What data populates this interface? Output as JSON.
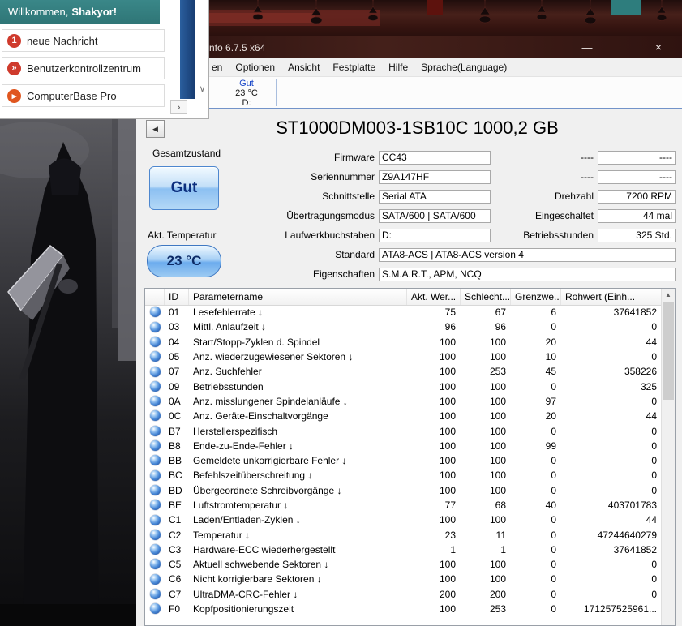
{
  "icons": {
    "back": "◀",
    "minimize": "—",
    "close": "×",
    "scroll_up": "▲",
    "chevron_down": "∨",
    "scroll_right": "›"
  },
  "overlay": {
    "title_prefix": "Willkommen,",
    "title_name": "Shakyor!",
    "items": [
      {
        "badge": "1",
        "label": "neue Nachricht"
      },
      {
        "badge": "»",
        "label": "Benutzerkontrollzentrum"
      },
      {
        "badge": "▸",
        "label": "ComputerBase Pro"
      }
    ]
  },
  "titlebar": {
    "title": "nfo 6.7.5 x64"
  },
  "menu": {
    "items": [
      "en",
      "Optionen",
      "Ansicht",
      "Festplatte",
      "Hilfe",
      "Sprache(Language)"
    ]
  },
  "drive_tab": {
    "status": "Gut",
    "temperature": "23 °C",
    "letter": "D:"
  },
  "header": {
    "model_title": "ST1000DM003-1SB10C 1000,2 GB",
    "health_label": "Gesamtzustand",
    "health_value": "Gut",
    "temp_label": "Akt. Temperatur",
    "temp_value": "23 °C"
  },
  "info": {
    "left": [
      {
        "label": "Firmware",
        "value": "CC43"
      },
      {
        "label": "Seriennummer",
        "value": "Z9A147HF"
      },
      {
        "label": "Schnittstelle",
        "value": "Serial ATA"
      },
      {
        "label": "Übertragungsmodus",
        "value": "SATA/600 | SATA/600"
      },
      {
        "label": "Laufwerkbuchstaben",
        "value": "D:"
      }
    ],
    "wide": [
      {
        "label": "Standard",
        "value": "ATA8-ACS | ATA8-ACS version 4"
      },
      {
        "label": "Eigenschaften",
        "value": "S.M.A.R.T., APM, NCQ"
      }
    ],
    "right": [
      {
        "label": "----",
        "value": "----"
      },
      {
        "label": "----",
        "value": "----"
      },
      {
        "label": "Drehzahl",
        "value": "7200 RPM"
      },
      {
        "label": "Eingeschaltet",
        "value": "44 mal"
      },
      {
        "label": "Betriebsstunden",
        "value": "325 Std."
      }
    ]
  },
  "smart": {
    "columns": {
      "id": "ID",
      "name": "Parametername",
      "current": "Akt. Wer...",
      "worst": "Schlecht...",
      "threshold": "Grenzwe...",
      "raw": "Rohwert (Einh..."
    },
    "rows": [
      {
        "id": "01",
        "name": "Lesefehlerrate ↓",
        "current": "75",
        "worst": "67",
        "threshold": "6",
        "raw": "37641852"
      },
      {
        "id": "03",
        "name": "Mittl. Anlaufzeit ↓",
        "current": "96",
        "worst": "96",
        "threshold": "0",
        "raw": "0"
      },
      {
        "id": "04",
        "name": "Start/Stopp-Zyklen d. Spindel",
        "current": "100",
        "worst": "100",
        "threshold": "20",
        "raw": "44"
      },
      {
        "id": "05",
        "name": "Anz. wiederzugewiesener Sektoren ↓",
        "current": "100",
        "worst": "100",
        "threshold": "10",
        "raw": "0"
      },
      {
        "id": "07",
        "name": "Anz. Suchfehler",
        "current": "100",
        "worst": "253",
        "threshold": "45",
        "raw": "358226"
      },
      {
        "id": "09",
        "name": "Betriebsstunden",
        "current": "100",
        "worst": "100",
        "threshold": "0",
        "raw": "325"
      },
      {
        "id": "0A",
        "name": "Anz. misslungener Spindelanläufe ↓",
        "current": "100",
        "worst": "100",
        "threshold": "97",
        "raw": "0"
      },
      {
        "id": "0C",
        "name": "Anz. Geräte-Einschaltvorgänge",
        "current": "100",
        "worst": "100",
        "threshold": "20",
        "raw": "44"
      },
      {
        "id": "B7",
        "name": "Herstellerspezifisch",
        "current": "100",
        "worst": "100",
        "threshold": "0",
        "raw": "0"
      },
      {
        "id": "B8",
        "name": "Ende-zu-Ende-Fehler ↓",
        "current": "100",
        "worst": "100",
        "threshold": "99",
        "raw": "0"
      },
      {
        "id": "BB",
        "name": "Gemeldete unkorrigierbare Fehler ↓",
        "current": "100",
        "worst": "100",
        "threshold": "0",
        "raw": "0"
      },
      {
        "id": "BC",
        "name": "Befehlszeitüberschreitung ↓",
        "current": "100",
        "worst": "100",
        "threshold": "0",
        "raw": "0"
      },
      {
        "id": "BD",
        "name": "Übergeordnete Schreibvorgänge ↓",
        "current": "100",
        "worst": "100",
        "threshold": "0",
        "raw": "0"
      },
      {
        "id": "BE",
        "name": "Luftstromtemperatur ↓",
        "current": "77",
        "worst": "68",
        "threshold": "40",
        "raw": "403701783"
      },
      {
        "id": "C1",
        "name": "Laden/Entladen-Zyklen ↓",
        "current": "100",
        "worst": "100",
        "threshold": "0",
        "raw": "44"
      },
      {
        "id": "C2",
        "name": "Temperatur ↓",
        "current": "23",
        "worst": "11",
        "threshold": "0",
        "raw": "47244640279"
      },
      {
        "id": "C3",
        "name": "Hardware-ECC wiederhergestellt",
        "current": "1",
        "worst": "1",
        "threshold": "0",
        "raw": "37641852"
      },
      {
        "id": "C5",
        "name": "Aktuell schwebende Sektoren ↓",
        "current": "100",
        "worst": "100",
        "threshold": "0",
        "raw": "0"
      },
      {
        "id": "C6",
        "name": "Nicht korrigierbare Sektoren ↓",
        "current": "100",
        "worst": "100",
        "threshold": "0",
        "raw": "0"
      },
      {
        "id": "C7",
        "name": "UltraDMA-CRC-Fehler ↓",
        "current": "200",
        "worst": "200",
        "threshold": "0",
        "raw": "0"
      },
      {
        "id": "F0",
        "name": "Kopfpositionierungszeit",
        "current": "100",
        "worst": "253",
        "threshold": "0",
        "raw": "171257525961..."
      }
    ]
  },
  "colors": {
    "accent_teal": "#337f80",
    "badge_red": "#cf3a2c",
    "badge_orange": "#e0561f",
    "health_button_border": "#4d87cf",
    "titlebar_dark_red": "#3a1712",
    "drive_status_blue": "#1846c8"
  }
}
